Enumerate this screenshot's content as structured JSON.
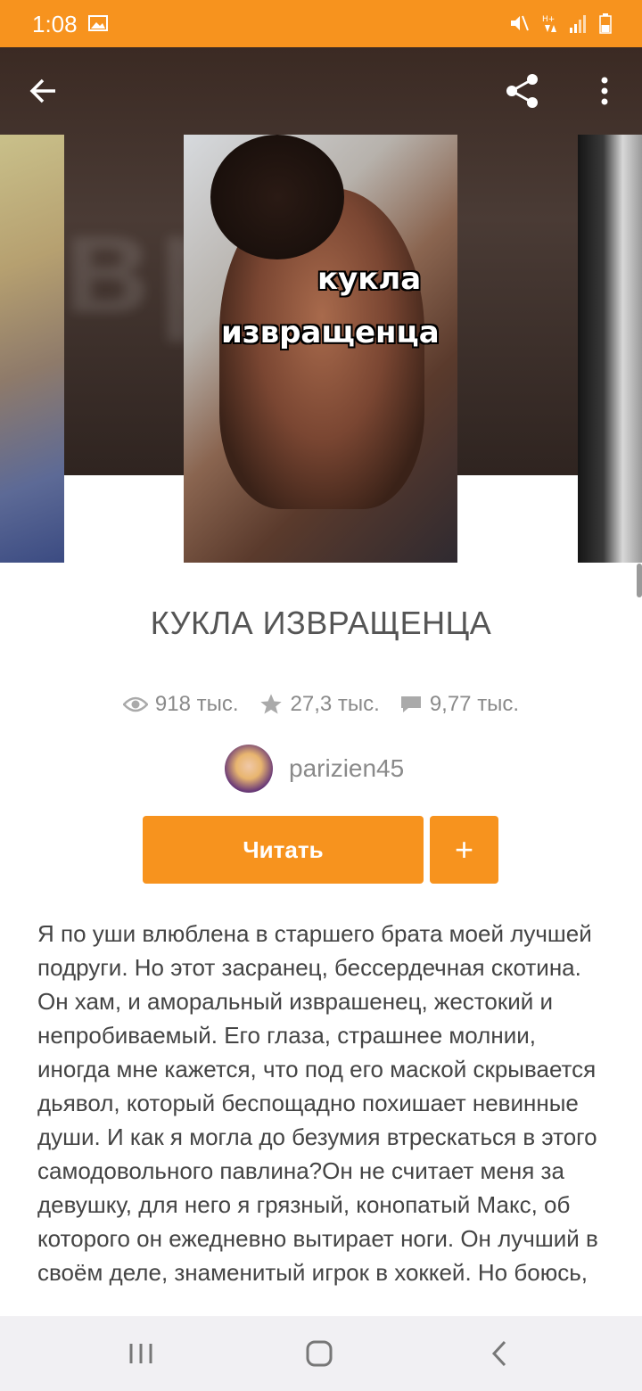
{
  "status_bar": {
    "time": "1:08",
    "icons": [
      "image-icon",
      "mute-icon",
      "data-icon",
      "signal-icon",
      "battery-icon"
    ]
  },
  "top_bar": {
    "icons": [
      "back-arrow-icon",
      "share-icon",
      "more-vertical-icon"
    ]
  },
  "cover": {
    "text_line1": "кукла",
    "text_line2": "извращенца"
  },
  "book": {
    "title": "КУКЛА ИЗВРАЩЕНЦА",
    "stats": {
      "views": "918 тыс.",
      "stars": "27,3 тыс.",
      "comments": "9,77 тыс."
    },
    "author": "parizien45"
  },
  "actions": {
    "read_label": "Читать",
    "add_label": "+"
  },
  "description": "Я по уши влюблена в старшего брата моей лучшей подруги. Но этот засранец, бессердечная скотина. Он хам, и аморальный изврашенец, жестокий и непробиваемый. Его глаза, страшнее молнии, иногда мне кажется, что под его маской скрывается дьявол, который беспощадно похишает невинные души. И как я могла до безумия втрескаться в этого самодовольного павлина?Он не считает меня за девушку, для него я грязный, конопатый Макс, об которого он ежедневно вытирает ноги. Он лучший в своём деле, знаменитый игрок в хоккей. Но боюсь,",
  "colors": {
    "accent": "#f7931e",
    "nav_bg": "#f1f0f3"
  },
  "nav_bar": {
    "icons": [
      "recent-apps-icon",
      "home-icon",
      "back-icon"
    ]
  }
}
